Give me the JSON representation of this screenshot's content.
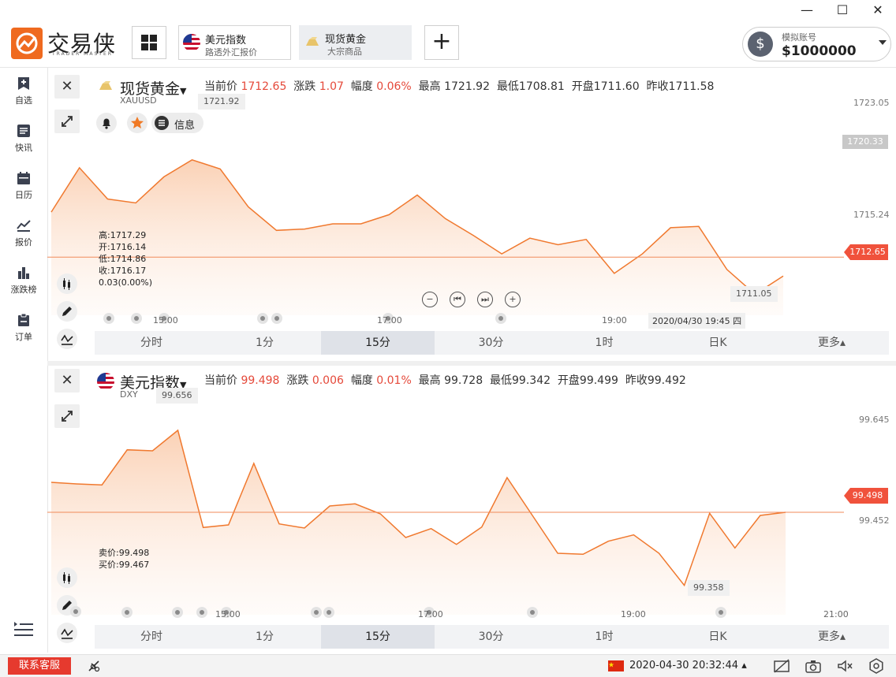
{
  "window": {
    "minimize": "—",
    "maximize": "☐",
    "close": "✕"
  },
  "header": {
    "logo_text": "交易侠",
    "logo_sub": "TRADER MASTER",
    "tabs": [
      {
        "title": "美元指数",
        "sub": "路透外汇报价"
      },
      {
        "title": "现货黄金",
        "sub": "大宗商品"
      }
    ],
    "add_label": "+",
    "account": {
      "label": "模拟账号",
      "balance": "$1000000"
    }
  },
  "sidebar": {
    "items": [
      {
        "label": "自选",
        "icon": "bookmark-add-icon"
      },
      {
        "label": "快讯",
        "icon": "news-icon"
      },
      {
        "label": "日历",
        "icon": "calendar-icon"
      },
      {
        "label": "报价",
        "icon": "quote-chart-icon"
      },
      {
        "label": "涨跌榜",
        "icon": "bar-rank-icon"
      },
      {
        "label": "订单",
        "icon": "order-clipboard-icon"
      }
    ]
  },
  "timeframes": [
    "分时",
    "1分",
    "15分",
    "30分",
    "1时",
    "日K",
    "更多▴"
  ],
  "panels": [
    {
      "name": "现货黄金",
      "code": "XAUUSD",
      "quote": {
        "current_label": "当前价",
        "current": "1712.65",
        "change_label": "涨跌",
        "change": "1.07",
        "pct_label": "幅度",
        "pct": "0.06%",
        "high_label": "最高",
        "high": "1721.92",
        "low_label": "最低",
        "low": "1708.81",
        "open_label": "开盘",
        "open": "1711.60",
        "prev_label": "昨收",
        "prev": "1711.58"
      },
      "info_label": "信息",
      "ohlc": "高:1717.29\n开:1716.14\n低:1714.86\n收:1716.17\n0.03(0.00%)",
      "y_ticks": [
        "1723.05",
        "1715.24"
      ],
      "hover_price": "1720.33",
      "last_price": "1712.65",
      "max_tip": "1721.92",
      "min_tip": "1711.05",
      "x_ticks": [
        "15:00",
        "17:00",
        "19:00"
      ],
      "crosshair_time": "2020/04/30 19:45 四"
    },
    {
      "name": "美元指数",
      "code": "DXY",
      "quote": {
        "current_label": "当前价",
        "current": "99.498",
        "change_label": "涨跌",
        "change": "0.006",
        "pct_label": "幅度",
        "pct": "0.01%",
        "high_label": "最高",
        "high": "99.728",
        "low_label": "最低",
        "low": "99.342",
        "open_label": "开盘",
        "open": "99.499",
        "prev_label": "昨收",
        "prev": "99.492"
      },
      "bidask": "卖价:99.498\n买价:99.467",
      "y_ticks": [
        "99.645",
        "99.452"
      ],
      "last_price": "99.498",
      "max_tip": "99.656",
      "min_tip": "99.358",
      "x_ticks": [
        "15:00",
        "17:00",
        "19:00",
        "21:00"
      ]
    }
  ],
  "status": {
    "support": "联系客服",
    "datetime": "2020-04-30 20:32:44 ▴"
  },
  "chart_data": [
    {
      "type": "area",
      "name": "XAUUSD",
      "interval": "15分",
      "ylim": [
        1709.4,
        1724.5
      ],
      "y": [
        1716.1,
        1719.5,
        1717.1,
        1716.8,
        1718.8,
        1720.1,
        1719.4,
        1716.5,
        1714.7,
        1714.8,
        1715.2,
        1715.2,
        1715.9,
        1717.4,
        1715.6,
        1714.3,
        1712.9,
        1714.1,
        1713.6,
        1714.0,
        1711.4,
        1712.9,
        1714.9,
        1715.0,
        1711.7,
        1709.8,
        1711.2
      ],
      "x_ticks": [
        "15:00",
        "17:00",
        "19:00"
      ],
      "reference_price": 1712.65
    },
    {
      "type": "area",
      "name": "DXY",
      "interval": "15分",
      "ylim": [
        99.3,
        99.72
      ],
      "y": [
        99.555,
        99.552,
        99.55,
        99.617,
        99.615,
        99.654,
        99.469,
        99.474,
        99.591,
        99.476,
        99.468,
        99.51,
        99.514,
        99.495,
        99.45,
        99.467,
        99.437,
        99.47,
        99.564,
        99.492,
        99.42,
        99.418,
        99.443,
        99.455,
        99.42,
        99.359,
        99.496,
        99.43,
        99.492,
        99.498
      ],
      "x_ticks": [
        "15:00",
        "17:00",
        "19:00",
        "21:00"
      ],
      "reference_price": 99.498
    }
  ]
}
